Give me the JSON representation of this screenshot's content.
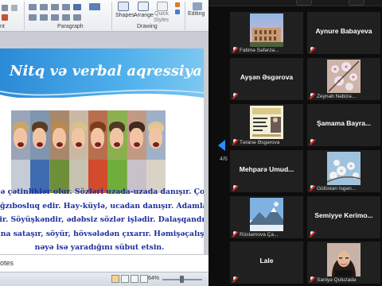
{
  "ppt": {
    "ribbon": {
      "groups": [
        {
          "id": "font",
          "label": ""
        },
        {
          "id": "paragraph",
          "label": "Paragraph"
        },
        {
          "id": "drawing",
          "label": "Drawing"
        },
        {
          "id": "editing",
          "label": "Editing"
        }
      ],
      "buttons": {
        "shapes": "Shapes",
        "arrange": "Arrange",
        "quick_styles_1": "Quick",
        "quick_styles_2": "Styles"
      },
      "font_group_partial_label": "nt"
    },
    "slide": {
      "title": "Nitq və verbal aqressiya",
      "header_color": "#2b8ad6",
      "text_color": "#1f2f9c",
      "lines": [
        "də çətinliklər olur. Sözləri uzada-uzada danışır.  Çox",
        "ağzıbosluq edir. Hay-küylə, ucadan danışır. Adamlar",
        "yir. Söyüşkəndir, ədəbsiz sözlər işlədir. Dalaşqandır.",
        "üna sataşır, söyür, hövsələdən çıxarır. Həmişəçalışır ki,",
        "nəyə isə yaradığını sübut etsin."
      ]
    },
    "notes_label": "otes",
    "status": {
      "zoom_label": "64%",
      "zoom_level_percent": 64
    }
  },
  "panel": {
    "page_label": "4/6",
    "nav_icon": "chevron-left-icon",
    "accent": "#2d8cff",
    "mic_muted_color": "#e02828",
    "participants": [
      {
        "name": "Fatimə Səfərzə...",
        "display": "thumbnail",
        "thumb": "colosseum",
        "muted": true
      },
      {
        "name": "Aynure Babayeva",
        "display": "name",
        "muted": true
      },
      {
        "name": "Ayşən Əsgərova",
        "display": "name",
        "muted": true
      },
      {
        "name": "Zeynəb Nəbizə...",
        "display": "thumbnail",
        "thumb": "blossoms",
        "muted": true
      },
      {
        "name": "Təranə Əsgərova",
        "display": "thumbnail",
        "thumb": "poster",
        "muted": true
      },
      {
        "name": "Şamama  Bayra...",
        "display": "name",
        "muted": true
      },
      {
        "name": "Mehparə  Umud...",
        "display": "name",
        "muted": true
      },
      {
        "name": "Gülüstan İsgən...",
        "display": "thumbnail",
        "thumb": "blossoms-sky",
        "muted": true
      },
      {
        "name": "Rüstəmova Ça...",
        "display": "thumbnail",
        "thumb": "mountain",
        "muted": true
      },
      {
        "name": "Semiyye  Kerimo...",
        "display": "name",
        "muted": true
      },
      {
        "name": "Lale",
        "display": "name",
        "muted": true
      },
      {
        "name": "Saniyə Quluzadə",
        "display": "thumbnail",
        "thumb": "portrait",
        "muted": true
      }
    ]
  }
}
